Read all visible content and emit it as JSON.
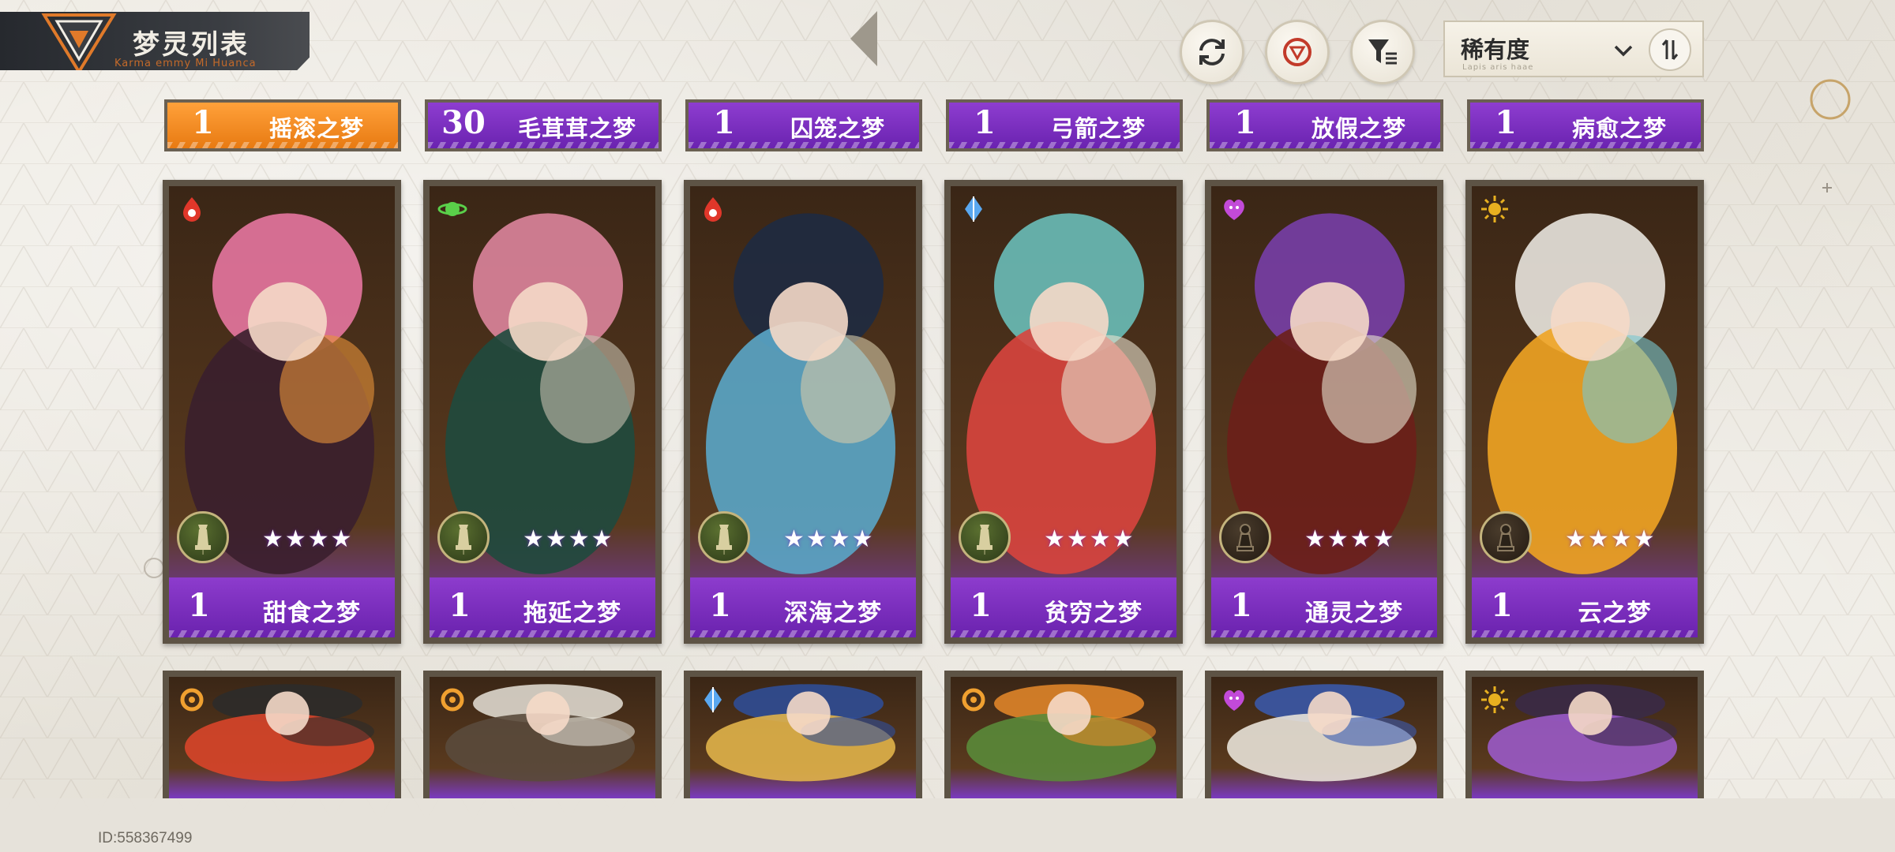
{
  "header": {
    "title": "梦灵列表",
    "subtitle": "Karma emmy Mi Huanca",
    "sort": {
      "label": "稀有度",
      "sub": "Lapis aris haae"
    }
  },
  "icons": {
    "refresh": "refresh-icon",
    "target": "target-icon",
    "filter": "filter-icon",
    "sort_order": "sort-order-icon"
  },
  "top_row": [
    {
      "count": "1",
      "name": "摇滚之梦",
      "style": "orange"
    },
    {
      "count": "30",
      "name": "毛茸茸之梦",
      "style": "purple"
    },
    {
      "count": "1",
      "name": "囚笼之梦",
      "style": "purple"
    },
    {
      "count": "1",
      "name": "弓箭之梦",
      "style": "purple"
    },
    {
      "count": "1",
      "name": "放假之梦",
      "style": "purple"
    },
    {
      "count": "1",
      "name": "病愈之梦",
      "style": "purple"
    }
  ],
  "cards": [
    {
      "count": "1",
      "name": "甜食之梦",
      "stars": "★★★★",
      "element": "flame-emblem-icon",
      "rank": "queen-piece-icon",
      "rank_style": "green",
      "palette": [
        "#f07aa8",
        "#3a1f2e",
        "#e8923a"
      ]
    },
    {
      "count": "1",
      "name": "拖延之梦",
      "stars": "★★★★",
      "element": "planet-icon",
      "rank": "queen-piece-icon",
      "rank_style": "green",
      "palette": [
        "#e58aa5",
        "#1f4a3e",
        "#c8c2b0"
      ]
    },
    {
      "count": "1",
      "name": "深海之梦",
      "stars": "★★★★",
      "element": "flame-emblem-icon",
      "rank": "queen-piece-icon",
      "rank_style": "green",
      "palette": [
        "#1c2a44",
        "#5aa6c8",
        "#d6c9a8"
      ]
    },
    {
      "count": "1",
      "name": "贫穷之梦",
      "stars": "★★★★",
      "element": "crystal-icon",
      "rank": "queen-piece-icon",
      "rank_style": "green",
      "palette": [
        "#6cc6c2",
        "#d8453e",
        "#e8e2d0"
      ]
    },
    {
      "count": "1",
      "name": "通灵之梦",
      "stars": "★★★★",
      "element": "heart-spirit-icon",
      "rank": "pawn-piece-icon",
      "rank_style": "dark",
      "palette": [
        "#7a3fb0",
        "#6b1f1a",
        "#e8e2d0"
      ]
    },
    {
      "count": "1",
      "name": "云之梦",
      "stars": "★★★★",
      "element": "sun-icon",
      "rank": "pawn-piece-icon",
      "rank_style": "dark",
      "palette": [
        "#f2f0ea",
        "#f0a424",
        "#78c8d0"
      ]
    }
  ],
  "second_row": [
    {
      "element": "ring-orbit-icon",
      "palette": [
        "#2c2c2c",
        "#d8452a"
      ]
    },
    {
      "element": "ring-orbit-icon",
      "palette": [
        "#e6e2d8",
        "#5a4a3c"
      ]
    },
    {
      "element": "crystal-icon",
      "palette": [
        "#2e4f9c",
        "#e0b24a"
      ]
    },
    {
      "element": "ring-orbit-icon",
      "palette": [
        "#e88a2a",
        "#5a8a3a"
      ]
    },
    {
      "element": "heart-spirit-icon",
      "palette": [
        "#3a5ab0",
        "#e8e2d8"
      ]
    },
    {
      "element": "sun-icon",
      "palette": [
        "#3a2a4a",
        "#9a5ac8"
      ]
    }
  ],
  "footer": {
    "uid": "ID:558367499"
  }
}
